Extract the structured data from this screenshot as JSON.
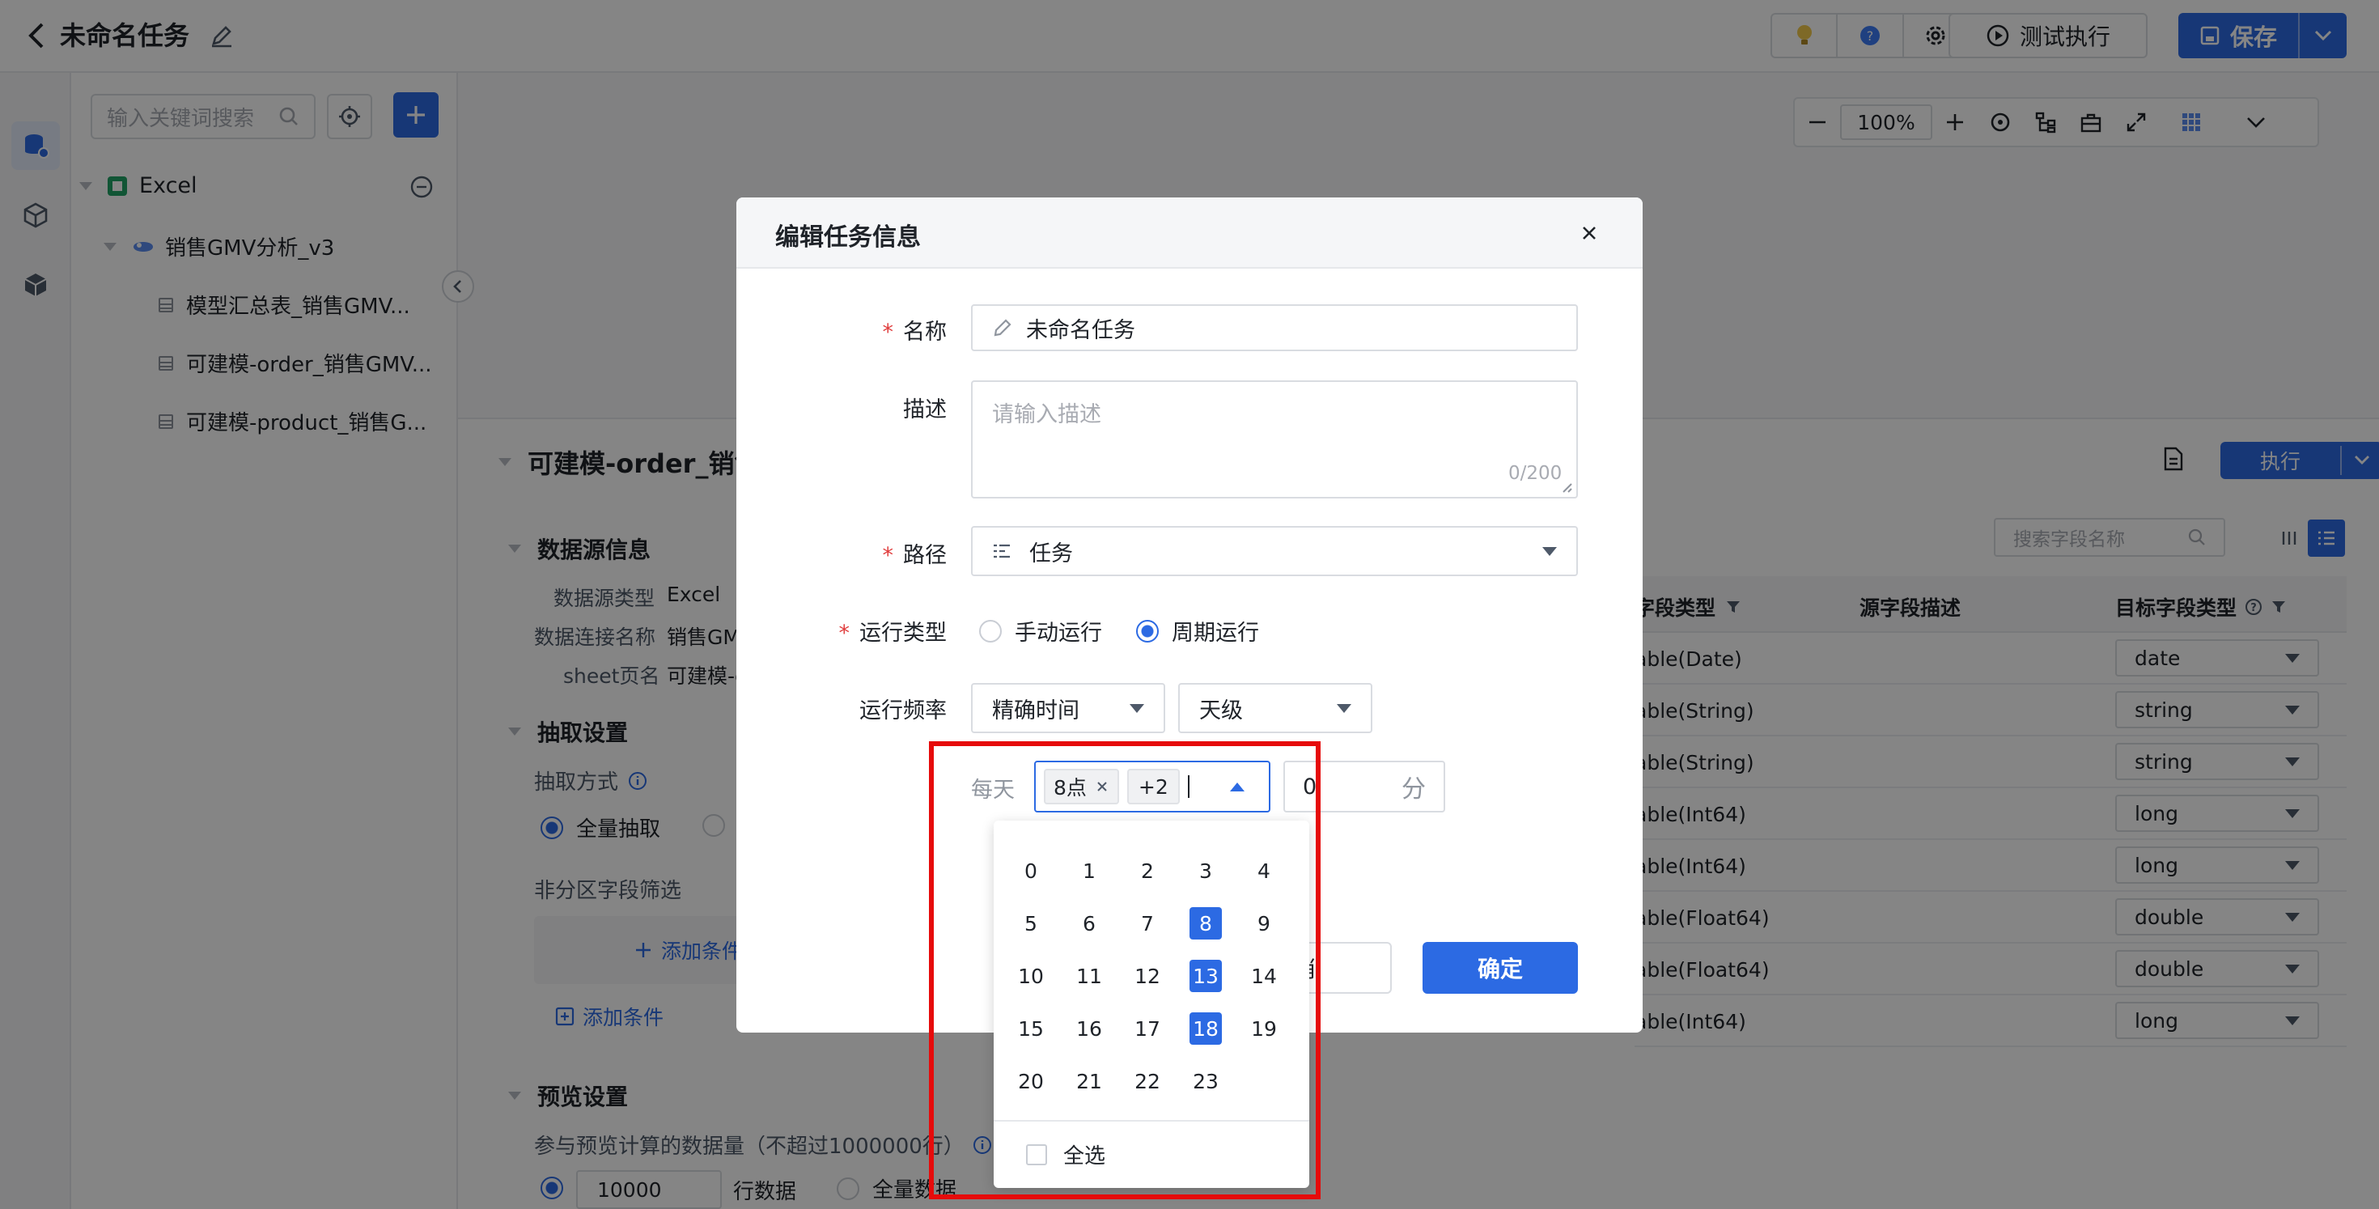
{
  "header": {
    "title": "未命名任务",
    "test_run": "测试执行",
    "save": "保存"
  },
  "tree": {
    "search_placeholder": "输入关键词搜索",
    "root": "Excel",
    "dataset": "销售GMV分析_v3",
    "tables": [
      "模型汇总表_销售GMV...",
      "可建模-order_销售GMV...",
      "可建模-product_销售G..."
    ]
  },
  "canvas": {
    "zoom": "100%"
  },
  "detail": {
    "title": "可建模-order_销售",
    "run": "执行",
    "ds_section": "数据源信息",
    "ds_type_label": "数据源类型",
    "ds_type": "Excel",
    "ds_conn_label": "数据连接名称",
    "ds_conn": "销售GM",
    "sheet_label": "sheet页名",
    "sheet": "可建模-c",
    "extract_section": "抽取设置",
    "extract_mode_label": "抽取方式",
    "extract_full": "全量抽取",
    "non_partition": "非分区字段筛选",
    "add_cond": "添加条件",
    "add_cond2": "添加条件",
    "preview_section": "预览设置",
    "preview_count_label": "参与预览计算的数据量（不超过1000000行）",
    "preview_rows": "10000",
    "rows_unit": "行数据",
    "preview_all": "全量数据",
    "field_search_placeholder": "搜索字段名称"
  },
  "field_table": {
    "headers": [
      "字段类型",
      "源字段描述",
      "目标字段类型"
    ],
    "rows": [
      {
        "src": "able(Date)",
        "dst": "date"
      },
      {
        "src": "able(String)",
        "dst": "string"
      },
      {
        "src": "able(String)",
        "dst": "string"
      },
      {
        "src": "able(Int64)",
        "dst": "long"
      },
      {
        "src": "able(Int64)",
        "dst": "long"
      },
      {
        "src": "able(Float64)",
        "dst": "double"
      },
      {
        "src": "able(Float64)",
        "dst": "double"
      },
      {
        "src": "able(Int64)",
        "dst": "long"
      }
    ]
  },
  "modal": {
    "title": "编辑任务信息",
    "name_label": "名称",
    "name_value": "未命名任务",
    "desc_label": "描述",
    "desc_placeholder": "请输入描述",
    "desc_count": "0/200",
    "path_label": "路径",
    "path_value": "任务",
    "run_type_label": "运行类型",
    "run_manual": "手动运行",
    "run_periodic": "周期运行",
    "freq_label": "运行频率",
    "freq_mode": "精确时间",
    "freq_level": "天级",
    "daily_label": "每天",
    "hour_tag": "8点",
    "more_tag": "+2",
    "minute_value": "0",
    "minute_unit": "分",
    "cancel": "取消",
    "confirm": "确定",
    "select_all": "全选",
    "hours": [
      "0",
      "1",
      "2",
      "3",
      "4",
      "5",
      "6",
      "7",
      "8",
      "9",
      "10",
      "11",
      "12",
      "13",
      "14",
      "15",
      "16",
      "17",
      "18",
      "19",
      "20",
      "21",
      "22",
      "23"
    ],
    "selected_hours": [
      "8",
      "13",
      "18"
    ]
  },
  "colors": {
    "primary": "#2c6ae3",
    "highlight": "#e60b0b",
    "required": "#e03e3e"
  }
}
